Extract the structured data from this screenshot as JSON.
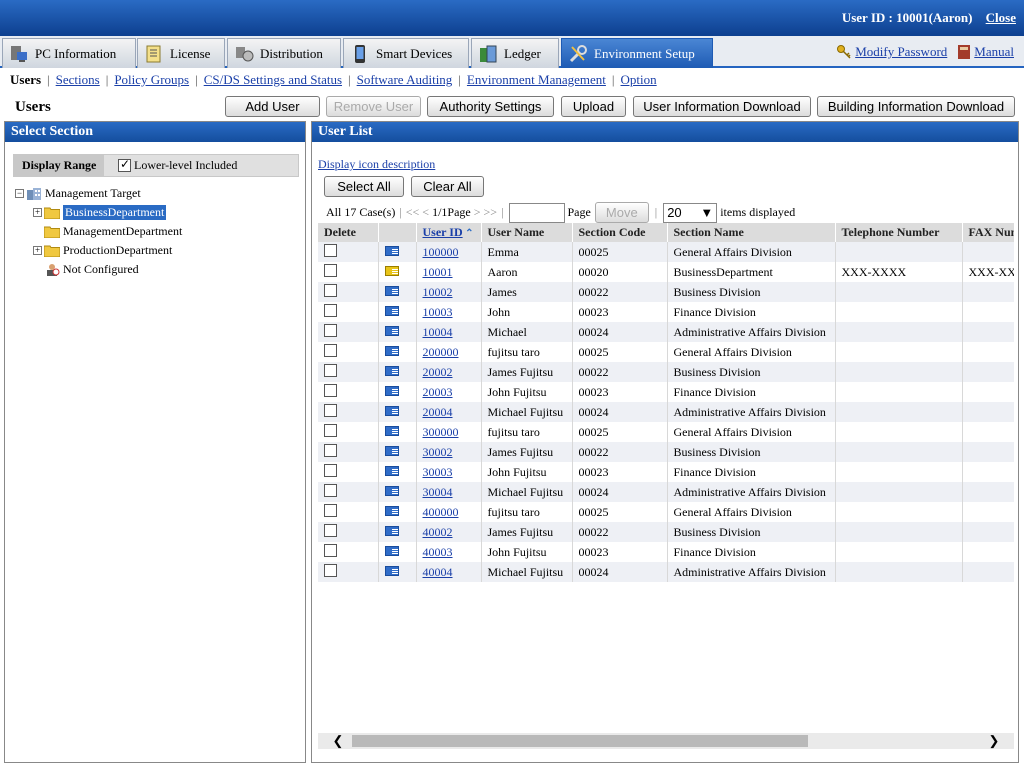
{
  "header": {
    "user_id_text": "User ID : 10001(Aaron)",
    "close_label": "Close"
  },
  "main_tabs": [
    {
      "label": "PC Information",
      "icon": "pc-icon"
    },
    {
      "label": "License",
      "icon": "license-icon"
    },
    {
      "label": "Distribution",
      "icon": "distribution-icon"
    },
    {
      "label": "Smart Devices",
      "icon": "smart-device-icon"
    },
    {
      "label": "Ledger",
      "icon": "ledger-icon"
    },
    {
      "label": "Environment Setup",
      "icon": "tools-icon",
      "active": true
    }
  ],
  "header_links": {
    "modify_password": "Modify Password",
    "manual": "Manual"
  },
  "subnav": {
    "items": [
      "Users",
      "Sections",
      "Policy Groups",
      "CS/DS Settings and Status",
      "Software Auditing",
      "Environment Management",
      "Option"
    ],
    "current": "Users"
  },
  "page": {
    "title": "Users",
    "buttons": {
      "add_user": "Add User",
      "remove_user": "Remove User",
      "authority_settings": "Authority Settings",
      "upload": "Upload",
      "user_info_download": "User Information Download",
      "building_info_download": "Building Information Download"
    }
  },
  "left_panel": {
    "title": "Select Section",
    "display_range_label": "Display Range",
    "lower_level_label": "Lower-level Included",
    "lower_level_checked": true,
    "tree": [
      {
        "label": "Management Target",
        "level": 0,
        "expander": "-"
      },
      {
        "label": "BusinessDepartment",
        "level": 1,
        "expander": "+",
        "selected": true
      },
      {
        "label": "ManagementDepartment",
        "level": 1,
        "expander": ""
      },
      {
        "label": "ProductionDepartment",
        "level": 1,
        "expander": "+"
      },
      {
        "label": "Not Configured",
        "level": 1,
        "expander": ""
      }
    ]
  },
  "right_panel": {
    "title": "User List",
    "display_icon_desc": "Display icon description",
    "select_all": "Select All",
    "clear_all": "Clear All",
    "pager": {
      "count_text": "All 17 Case(s)",
      "nav_first": "<<",
      "nav_prev": "<",
      "page_text": "1/1Page",
      "nav_next": ">",
      "nav_last": ">>",
      "page_label": "Page",
      "move": "Move",
      "per_page": "20",
      "items_displayed": "items displayed"
    },
    "columns": [
      "Delete",
      "",
      "User ID",
      "User Name",
      "Section Code",
      "Section Name",
      "Telephone Number",
      "FAX Num"
    ],
    "rows": [
      {
        "id": "100000",
        "name": "Emma",
        "code": "00025",
        "section": "General Affairs Division",
        "tel": "",
        "fax": "",
        "icon": "user-card-icon"
      },
      {
        "id": "10001",
        "name": "Aaron",
        "code": "00020",
        "section": "BusinessDepartment",
        "tel": "XXX-XXXX",
        "fax": "XXX-XX",
        "icon": "admin-user-card-icon"
      },
      {
        "id": "10002",
        "name": "James",
        "code": "00022",
        "section": "Business Division",
        "tel": "",
        "fax": "",
        "icon": "user-card-icon"
      },
      {
        "id": "10003",
        "name": "John",
        "code": "00023",
        "section": "Finance Division",
        "tel": "",
        "fax": "",
        "icon": "user-card-icon"
      },
      {
        "id": "10004",
        "name": "Michael",
        "code": "00024",
        "section": "Administrative Affairs Division",
        "tel": "",
        "fax": "",
        "icon": "user-card-icon"
      },
      {
        "id": "200000",
        "name": "fujitsu taro",
        "code": "00025",
        "section": "General Affairs Division",
        "tel": "",
        "fax": "",
        "icon": "user-card-icon"
      },
      {
        "id": "20002",
        "name": "James Fujitsu",
        "code": "00022",
        "section": "Business Division",
        "tel": "",
        "fax": "",
        "icon": "user-card-icon"
      },
      {
        "id": "20003",
        "name": "John Fujitsu",
        "code": "00023",
        "section": "Finance Division",
        "tel": "",
        "fax": "",
        "icon": "user-card-icon"
      },
      {
        "id": "20004",
        "name": "Michael Fujitsu",
        "code": "00024",
        "section": "Administrative Affairs Division",
        "tel": "",
        "fax": "",
        "icon": "user-card-icon"
      },
      {
        "id": "300000",
        "name": "fujitsu taro",
        "code": "00025",
        "section": "General Affairs Division",
        "tel": "",
        "fax": "",
        "icon": "user-card-icon"
      },
      {
        "id": "30002",
        "name": "James Fujitsu",
        "code": "00022",
        "section": "Business Division",
        "tel": "",
        "fax": "",
        "icon": "user-card-icon"
      },
      {
        "id": "30003",
        "name": "John Fujitsu",
        "code": "00023",
        "section": "Finance Division",
        "tel": "",
        "fax": "",
        "icon": "user-card-icon"
      },
      {
        "id": "30004",
        "name": "Michael Fujitsu",
        "code": "00024",
        "section": "Administrative Affairs Division",
        "tel": "",
        "fax": "",
        "icon": "user-card-icon"
      },
      {
        "id": "400000",
        "name": "fujitsu taro",
        "code": "00025",
        "section": "General Affairs Division",
        "tel": "",
        "fax": "",
        "icon": "user-card-icon"
      },
      {
        "id": "40002",
        "name": "James Fujitsu",
        "code": "00022",
        "section": "Business Division",
        "tel": "",
        "fax": "",
        "icon": "user-card-icon"
      },
      {
        "id": "40003",
        "name": "John Fujitsu",
        "code": "00023",
        "section": "Finance Division",
        "tel": "",
        "fax": "",
        "icon": "user-card-icon"
      },
      {
        "id": "40004",
        "name": "Michael Fujitsu",
        "code": "00024",
        "section": "Administrative Affairs Division",
        "tel": "",
        "fax": "",
        "icon": "user-card-icon"
      }
    ]
  },
  "colors": {
    "brand_blue": "#1e5bb4",
    "link": "#1a3fa8",
    "header_gray": "#dcdcdc",
    "row_alt": "#eef0f5"
  }
}
